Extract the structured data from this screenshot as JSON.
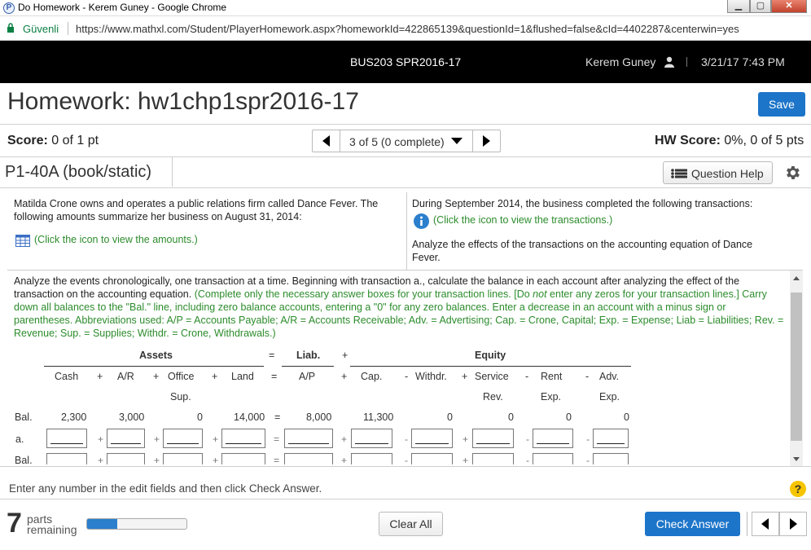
{
  "window": {
    "title": "Do Homework - Kerem Guney - Google Chrome",
    "favicon_letter": "P",
    "buttons": [
      "minimize",
      "maximize",
      "close"
    ]
  },
  "addressbar": {
    "secure_label": "Güvenli",
    "url": "https://www.mathxl.com/Student/PlayerHomework.aspx?homeworkId=422865139&questionId=1&flushed=false&cId=4402287&centerwin=yes"
  },
  "topbar": {
    "course": "BUS203 SPR2016-17",
    "user": "Kerem Guney",
    "datetime": "3/21/17 7:43 PM"
  },
  "homework": {
    "title": "Homework: hw1chp1spr2016-17",
    "save_label": "Save"
  },
  "scorebar": {
    "score_label": "Score:",
    "score_value": " 0 of 1 pt",
    "nav_text": "3 of 5 (0 complete)",
    "hw_score_label": "HW Score:",
    "hw_score_value": " 0%, 0 of 5 pts"
  },
  "problem": {
    "tag": "P1-40A (book/static)",
    "question_help_label": "Question Help",
    "left_text": "Matilda Crone owns and operates a public relations firm called Dance Fever. The following amounts summarize her business on August 31, 2014:",
    "left_link": "(Click the icon to view the amounts.)",
    "right_text": "During September 2014, the business completed the following transactions:",
    "right_link": "(Click the icon to view the transactions.)",
    "right_text2": "Analyze the effects of the transactions on the accounting equation of Dance Fever.",
    "instructions_black": "Analyze the events chronologically, one transaction at a time. Beginning with transaction a., calculate the balance in each account after analyzing the effect of the transaction on the accounting equation. ",
    "instructions_green_1": "(Complete only the necessary answer boxes for your transaction lines. [Do ",
    "instructions_green_not": "not",
    "instructions_green_2": " enter any zeros for your transaction lines.] Carry down all balances to the \"Bal.\" line, including zero balance accounts, entering a \"0\" for any zero balances. Enter a decrease in an account with a minus sign or parentheses. Abbreviations used: A/P = Accounts Payable; A/R = Accounts Receivable; Adv. = Advertising; Cap. = Crone, Capital; Exp. = Expense; Liab = Liabilities; Rev. = Revenue; Sup. = Supplies; Withdr. = Crone, Withdrawals.)"
  },
  "table": {
    "group_assets": "Assets",
    "eq": "=",
    "group_liab": "Liab.",
    "plus": "+",
    "group_equity": "Equity",
    "columns": [
      "Cash",
      "A/R",
      "Office",
      "Land",
      "A/P",
      "Cap.",
      "Withdr.",
      "Service",
      "Rent",
      "Adv."
    ],
    "columns_line2": [
      "",
      "",
      "Sup.",
      "",
      "",
      "",
      "",
      "Rev.",
      "Exp.",
      "Exp."
    ],
    "operators": [
      "+",
      "+",
      "+",
      "=",
      "+",
      "-",
      "+",
      "-",
      "-"
    ],
    "row_labels": [
      "Bal.",
      "a.",
      "Bal."
    ],
    "bal_values": [
      "2,300",
      "3,000",
      "0",
      "14,000",
      "8,000",
      "11,300",
      "0",
      "0",
      "0",
      "0"
    ]
  },
  "footer": {
    "instruction": "Enter any number in the edit fields and then click Check Answer.",
    "help": "?",
    "parts_count": "7",
    "parts_label_1": "parts",
    "parts_label_2": "remaining",
    "progress_fraction": 0.3,
    "clear_all_label": "Clear All",
    "check_answer_label": "Check Answer"
  }
}
